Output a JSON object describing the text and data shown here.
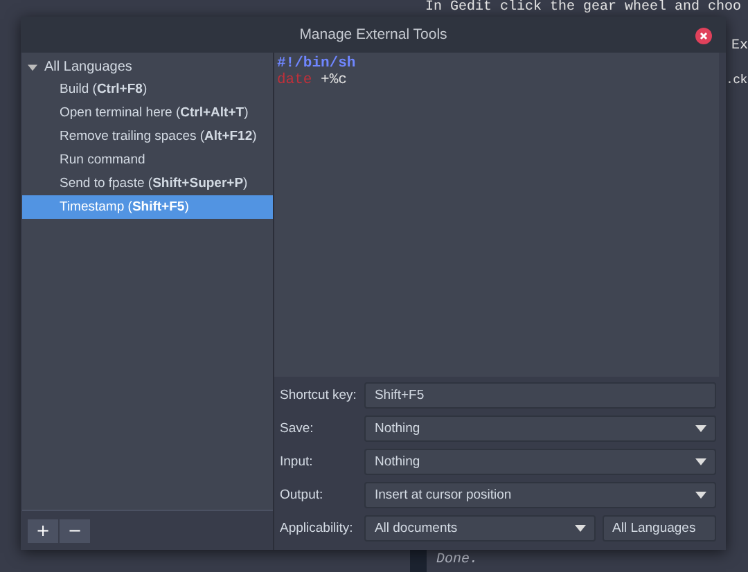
{
  "background_document": {
    "lines": [
      "In Gedit click the gear wheel and choo",
      "Ex",
      ".ck",
      "Done."
    ]
  },
  "window": {
    "title": "Manage External Tools"
  },
  "tools_tree": {
    "label": "All Languages",
    "expanded": true,
    "children": [
      {
        "label": "Build (**Ctrl+F8**)",
        "selected": false
      },
      {
        "label": "Open terminal here (**Ctrl+Alt+T**)",
        "selected": false
      },
      {
        "label": "Remove trailing spaces (**Alt+F12**)",
        "selected": false
      },
      {
        "label": "Run command",
        "selected": false
      },
      {
        "label": "Send to fpaste (**Shift+Super+P**)",
        "selected": false
      },
      {
        "label": "Timestamp (**Shift+F5**)",
        "selected": true
      }
    ]
  },
  "toolbar": [
    "+",
    "−"
  ],
  "editor": {
    "lines": [
      [
        {
          "kind": "shebang",
          "text": "#!/bin/sh"
        }
      ],
      [
        {
          "kind": "command",
          "text": "date"
        },
        {
          "kind": "plain",
          "text": " +%c"
        }
      ]
    ]
  },
  "form": {
    "shortcut_key": {
      "label": "Shortcut key:",
      "value": "Shift+F5"
    },
    "save": {
      "label": "Save:",
      "value": "Nothing"
    },
    "input": {
      "label": "Input:",
      "value": "Nothing"
    },
    "output": {
      "label": "Output:",
      "value": "Insert at cursor position"
    },
    "applicability": {
      "label": "Applicability:",
      "value": "All documents",
      "languages": "All Languages"
    }
  }
}
